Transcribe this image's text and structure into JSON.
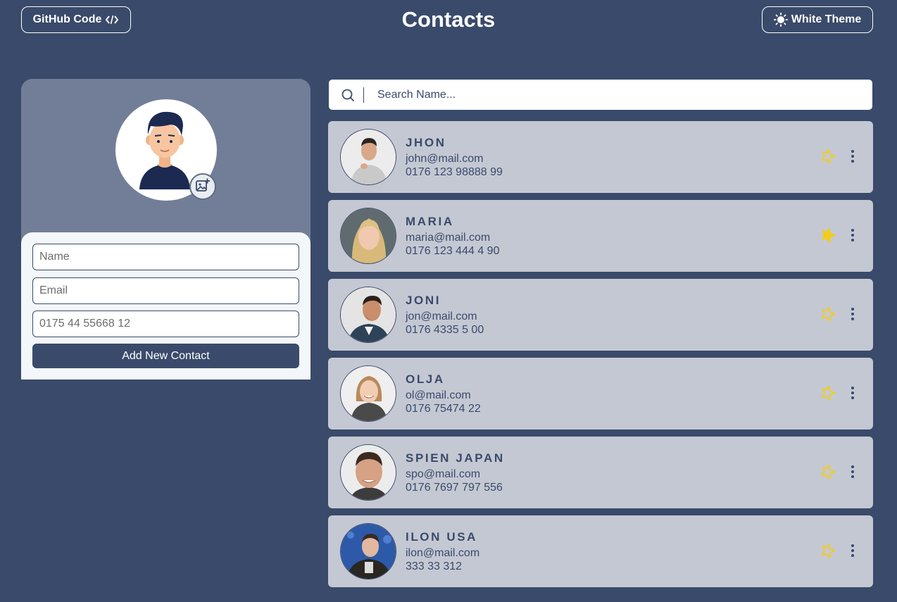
{
  "header": {
    "github_label": "GitHub Code",
    "title": "Contacts",
    "theme_label": "White Theme"
  },
  "form": {
    "name_placeholder": "Name",
    "email_placeholder": "Email",
    "phone_placeholder": "0175 44 55668 12",
    "submit_label": "Add New Contact"
  },
  "search": {
    "placeholder": "Search Name..."
  },
  "colors": {
    "background": "#3a4a6a",
    "card": "#c4c8d3",
    "star": "#f2cd1d",
    "panel_top": "#727e97",
    "panel_bottom": "#f4f7fa"
  },
  "contacts": [
    {
      "name": "JHON",
      "email": "john@mail.com",
      "phone": "0176 123 98888 99",
      "favorite": false,
      "icon": "star-outline-icon"
    },
    {
      "name": "MARIA",
      "email": "maria@mail.com",
      "phone": "0176 123 444 4 90",
      "favorite": true,
      "icon": "star-filled-icon"
    },
    {
      "name": "JONI",
      "email": "jon@mail.com",
      "phone": "0176 4335 5 00",
      "favorite": false,
      "icon": "star-outline-icon"
    },
    {
      "name": "OLJA",
      "email": "ol@mail.com",
      "phone": "0176 75474 22",
      "favorite": false,
      "icon": "star-outline-icon"
    },
    {
      "name": "SPIEN JAPAN",
      "email": "spo@mail.com",
      "phone": "0176 7697 797 556",
      "favorite": false,
      "icon": "star-outline-icon"
    },
    {
      "name": "ILON USA",
      "email": "ilon@mail.com",
      "phone": "333 33 312",
      "favorite": false,
      "icon": "star-outline-icon"
    }
  ]
}
